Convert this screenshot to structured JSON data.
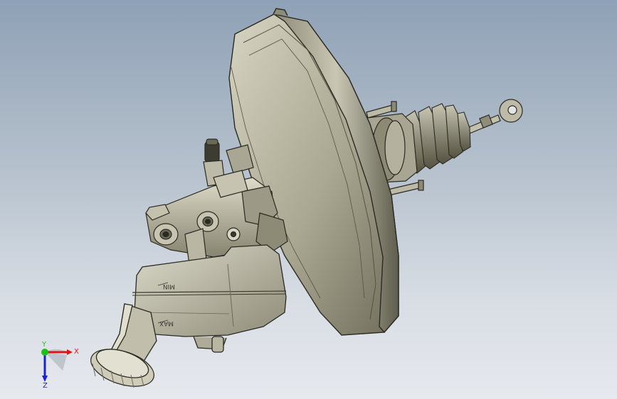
{
  "model": {
    "reservoir_marks": {
      "min": "MIN",
      "max": "MAX"
    }
  },
  "triad": {
    "x_label": "X",
    "y_label": "Y",
    "z_label": "Z",
    "x_color": "#e01515",
    "y_color": "#1cc21c",
    "z_color": "#1a22d6"
  },
  "colors": {
    "metal_light": "#cdcbb9",
    "metal_mid": "#a6a48f",
    "metal_dark": "#6c6a58",
    "edge": "#2a2a22"
  }
}
